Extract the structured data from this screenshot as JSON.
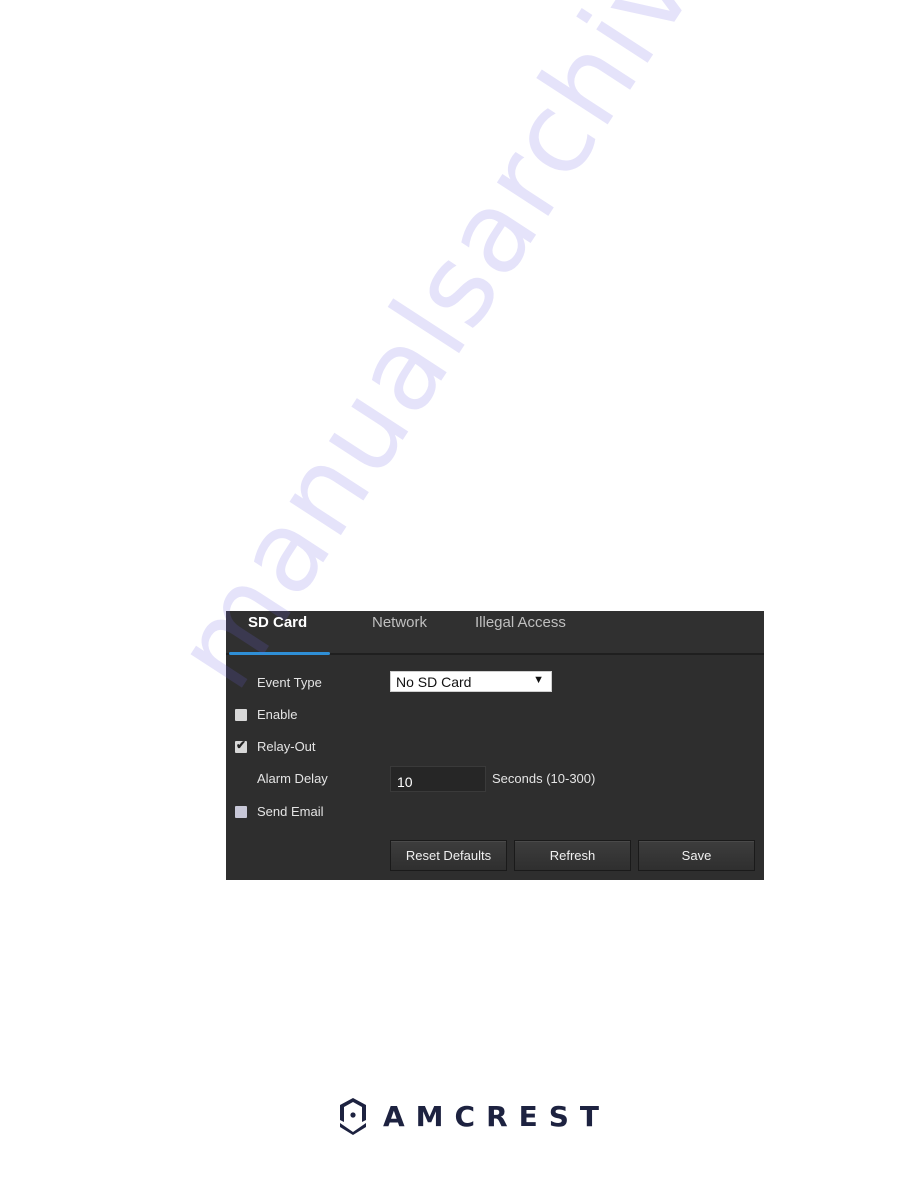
{
  "watermark": "manualsarchive.com",
  "panel": {
    "tabs": [
      {
        "label": "SD Card",
        "active": true
      },
      {
        "label": "Network",
        "active": false
      },
      {
        "label": "Illegal Access",
        "active": false
      }
    ],
    "accent_color": "#2f8fd6",
    "event_type": {
      "label": "Event Type",
      "selected": "No SD Card"
    },
    "enable": {
      "label": "Enable",
      "checked": false
    },
    "relay_out": {
      "label": "Relay-Out",
      "checked": true
    },
    "alarm_delay": {
      "label": "Alarm Delay",
      "value": "10",
      "unit": "Seconds (10-300)"
    },
    "send_email": {
      "label": "Send Email",
      "checked": false,
      "disabled": true
    },
    "buttons": {
      "reset": "Reset Defaults",
      "refresh": "Refresh",
      "save": "Save"
    }
  },
  "footer": {
    "brand": "AMCREST"
  }
}
